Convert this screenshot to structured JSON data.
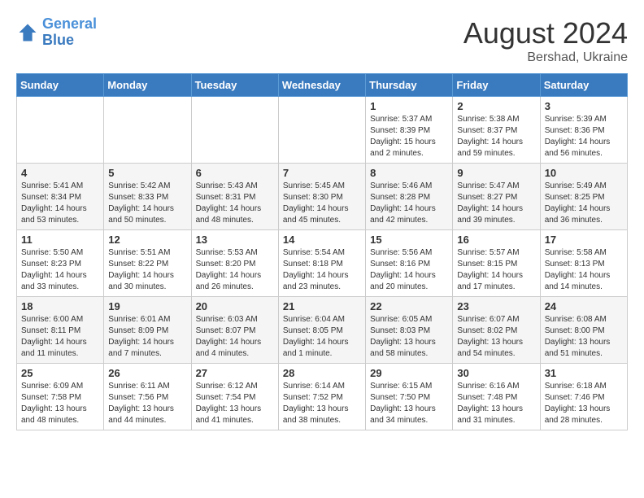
{
  "header": {
    "logo_general": "General",
    "logo_blue": "Blue",
    "month_year": "August 2024",
    "location": "Bershad, Ukraine"
  },
  "days_of_week": [
    "Sunday",
    "Monday",
    "Tuesday",
    "Wednesday",
    "Thursday",
    "Friday",
    "Saturday"
  ],
  "weeks": [
    [
      {
        "day": "",
        "info": ""
      },
      {
        "day": "",
        "info": ""
      },
      {
        "day": "",
        "info": ""
      },
      {
        "day": "",
        "info": ""
      },
      {
        "day": "1",
        "info": "Sunrise: 5:37 AM\nSunset: 8:39 PM\nDaylight: 15 hours\nand 2 minutes."
      },
      {
        "day": "2",
        "info": "Sunrise: 5:38 AM\nSunset: 8:37 PM\nDaylight: 14 hours\nand 59 minutes."
      },
      {
        "day": "3",
        "info": "Sunrise: 5:39 AM\nSunset: 8:36 PM\nDaylight: 14 hours\nand 56 minutes."
      }
    ],
    [
      {
        "day": "4",
        "info": "Sunrise: 5:41 AM\nSunset: 8:34 PM\nDaylight: 14 hours\nand 53 minutes."
      },
      {
        "day": "5",
        "info": "Sunrise: 5:42 AM\nSunset: 8:33 PM\nDaylight: 14 hours\nand 50 minutes."
      },
      {
        "day": "6",
        "info": "Sunrise: 5:43 AM\nSunset: 8:31 PM\nDaylight: 14 hours\nand 48 minutes."
      },
      {
        "day": "7",
        "info": "Sunrise: 5:45 AM\nSunset: 8:30 PM\nDaylight: 14 hours\nand 45 minutes."
      },
      {
        "day": "8",
        "info": "Sunrise: 5:46 AM\nSunset: 8:28 PM\nDaylight: 14 hours\nand 42 minutes."
      },
      {
        "day": "9",
        "info": "Sunrise: 5:47 AM\nSunset: 8:27 PM\nDaylight: 14 hours\nand 39 minutes."
      },
      {
        "day": "10",
        "info": "Sunrise: 5:49 AM\nSunset: 8:25 PM\nDaylight: 14 hours\nand 36 minutes."
      }
    ],
    [
      {
        "day": "11",
        "info": "Sunrise: 5:50 AM\nSunset: 8:23 PM\nDaylight: 14 hours\nand 33 minutes."
      },
      {
        "day": "12",
        "info": "Sunrise: 5:51 AM\nSunset: 8:22 PM\nDaylight: 14 hours\nand 30 minutes."
      },
      {
        "day": "13",
        "info": "Sunrise: 5:53 AM\nSunset: 8:20 PM\nDaylight: 14 hours\nand 26 minutes."
      },
      {
        "day": "14",
        "info": "Sunrise: 5:54 AM\nSunset: 8:18 PM\nDaylight: 14 hours\nand 23 minutes."
      },
      {
        "day": "15",
        "info": "Sunrise: 5:56 AM\nSunset: 8:16 PM\nDaylight: 14 hours\nand 20 minutes."
      },
      {
        "day": "16",
        "info": "Sunrise: 5:57 AM\nSunset: 8:15 PM\nDaylight: 14 hours\nand 17 minutes."
      },
      {
        "day": "17",
        "info": "Sunrise: 5:58 AM\nSunset: 8:13 PM\nDaylight: 14 hours\nand 14 minutes."
      }
    ],
    [
      {
        "day": "18",
        "info": "Sunrise: 6:00 AM\nSunset: 8:11 PM\nDaylight: 14 hours\nand 11 minutes."
      },
      {
        "day": "19",
        "info": "Sunrise: 6:01 AM\nSunset: 8:09 PM\nDaylight: 14 hours\nand 7 minutes."
      },
      {
        "day": "20",
        "info": "Sunrise: 6:03 AM\nSunset: 8:07 PM\nDaylight: 14 hours\nand 4 minutes."
      },
      {
        "day": "21",
        "info": "Sunrise: 6:04 AM\nSunset: 8:05 PM\nDaylight: 14 hours\nand 1 minute."
      },
      {
        "day": "22",
        "info": "Sunrise: 6:05 AM\nSunset: 8:03 PM\nDaylight: 13 hours\nand 58 minutes."
      },
      {
        "day": "23",
        "info": "Sunrise: 6:07 AM\nSunset: 8:02 PM\nDaylight: 13 hours\nand 54 minutes."
      },
      {
        "day": "24",
        "info": "Sunrise: 6:08 AM\nSunset: 8:00 PM\nDaylight: 13 hours\nand 51 minutes."
      }
    ],
    [
      {
        "day": "25",
        "info": "Sunrise: 6:09 AM\nSunset: 7:58 PM\nDaylight: 13 hours\nand 48 minutes."
      },
      {
        "day": "26",
        "info": "Sunrise: 6:11 AM\nSunset: 7:56 PM\nDaylight: 13 hours\nand 44 minutes."
      },
      {
        "day": "27",
        "info": "Sunrise: 6:12 AM\nSunset: 7:54 PM\nDaylight: 13 hours\nand 41 minutes."
      },
      {
        "day": "28",
        "info": "Sunrise: 6:14 AM\nSunset: 7:52 PM\nDaylight: 13 hours\nand 38 minutes."
      },
      {
        "day": "29",
        "info": "Sunrise: 6:15 AM\nSunset: 7:50 PM\nDaylight: 13 hours\nand 34 minutes."
      },
      {
        "day": "30",
        "info": "Sunrise: 6:16 AM\nSunset: 7:48 PM\nDaylight: 13 hours\nand 31 minutes."
      },
      {
        "day": "31",
        "info": "Sunrise: 6:18 AM\nSunset: 7:46 PM\nDaylight: 13 hours\nand 28 minutes."
      }
    ]
  ]
}
